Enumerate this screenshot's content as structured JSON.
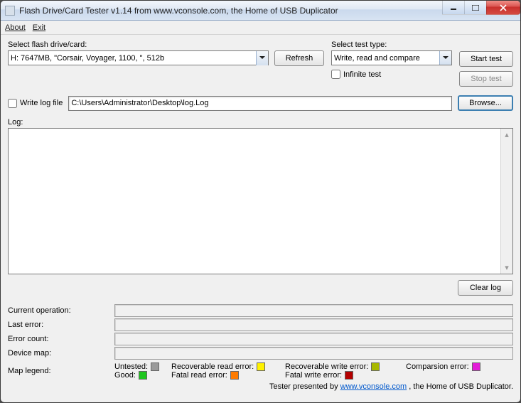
{
  "window": {
    "title": "Flash Drive/Card Tester v1.14 from www.vconsole.com, the Home of USB Duplicator"
  },
  "menu": {
    "about": "About",
    "exit": "Exit"
  },
  "drive_section": {
    "label": "Select flash drive/card:",
    "selected": "H: 7647MB, \"Corsair, Voyager, 1100, \", 512b",
    "refresh": "Refresh"
  },
  "test_section": {
    "label": "Select test type:",
    "selected": "Write, read and compare",
    "infinite_label": "Infinite test",
    "infinite_checked": false
  },
  "actions": {
    "start": "Start test",
    "stop": "Stop test"
  },
  "logfile": {
    "checkbox_label": "Write log file",
    "checked": false,
    "path": "C:\\Users\\Administrator\\Desktop\\log.Log",
    "browse": "Browse..."
  },
  "log": {
    "label": "Log:",
    "content": "",
    "clear": "Clear log"
  },
  "status": {
    "current_op_label": "Current operation:",
    "current_op": "",
    "last_error_label": "Last error:",
    "last_error": "",
    "error_count_label": "Error count:",
    "error_count": "",
    "device_map_label": "Device map:",
    "device_map": ""
  },
  "legend": {
    "label": "Map legend:",
    "items": {
      "untested": {
        "label": "Untested:",
        "color": "#9a9a9a"
      },
      "good": {
        "label": "Good:",
        "color": "#1ec61e"
      },
      "rec_read": {
        "label": "Recoverable read error:",
        "color": "#fff200"
      },
      "fatal_read": {
        "label": "Fatal read error:",
        "color": "#ff7b00"
      },
      "rec_write": {
        "label": "Recoverable write error:",
        "color": "#a8b800"
      },
      "fatal_write": {
        "label": "Fatal write error:",
        "color": "#b40000"
      },
      "comparsion": {
        "label": "Comparsion error:",
        "color": "#e31bd8"
      }
    }
  },
  "footer": {
    "prefix": "Tester presented by ",
    "link_text": "www.vconsole.com",
    "suffix": " , the Home of USB Duplicator."
  }
}
